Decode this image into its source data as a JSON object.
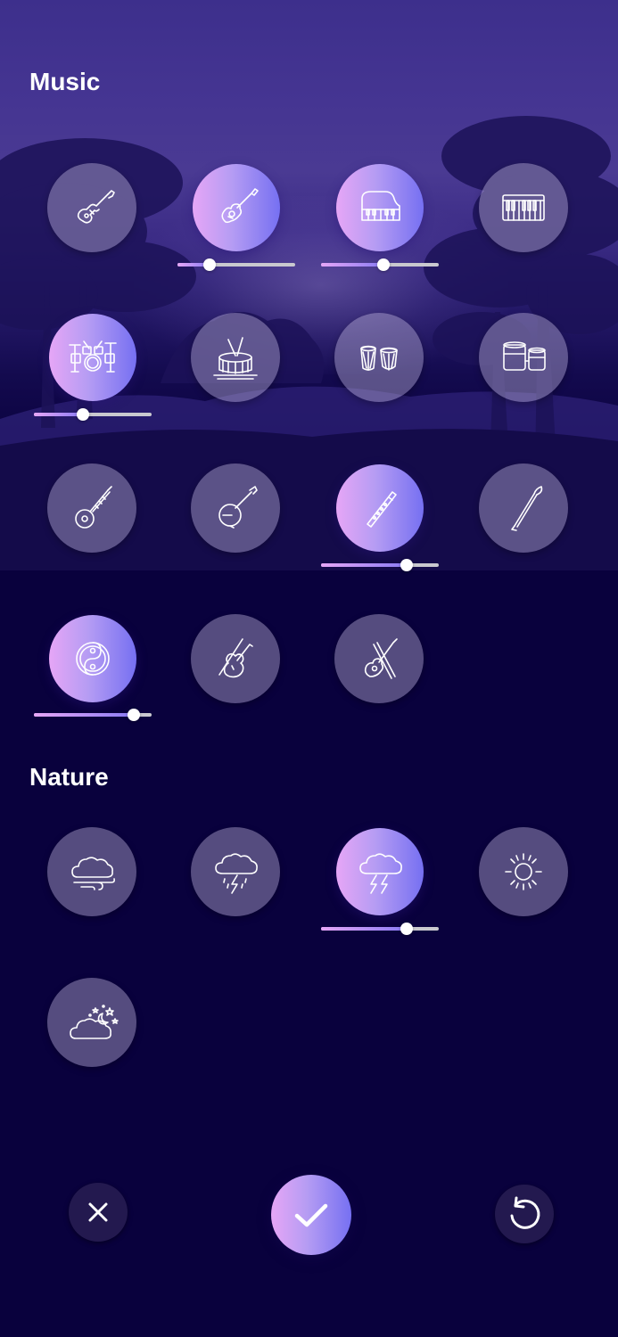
{
  "sections": {
    "music_title": "Music",
    "nature_title": "Nature"
  },
  "music": [
    {
      "name": "electric-guitar",
      "icon": "electric-guitar-icon",
      "active": false
    },
    {
      "name": "acoustic-guitar",
      "icon": "acoustic-guitar-icon",
      "active": true,
      "volume": 0.27
    },
    {
      "name": "grand-piano",
      "icon": "grand-piano-icon",
      "active": true,
      "volume": 0.53
    },
    {
      "name": "keyboard",
      "icon": "keyboard-icon",
      "active": false
    },
    {
      "name": "drum-kit",
      "icon": "drum-kit-icon",
      "active": true,
      "volume": 0.42
    },
    {
      "name": "snare-drum",
      "icon": "snare-drum-icon",
      "active": false
    },
    {
      "name": "tabla",
      "icon": "tabla-icon",
      "active": false
    },
    {
      "name": "bongos",
      "icon": "bongos-icon",
      "active": false
    },
    {
      "name": "sitar",
      "icon": "sitar-icon",
      "active": false
    },
    {
      "name": "banjo",
      "icon": "banjo-icon",
      "active": false
    },
    {
      "name": "flute",
      "icon": "flute-icon",
      "active": true,
      "volume": 0.73
    },
    {
      "name": "shehnai",
      "icon": "shehnai-icon",
      "active": false
    },
    {
      "name": "yin-yang",
      "icon": "yin-yang-icon",
      "active": true,
      "volume": 0.85
    },
    {
      "name": "violin",
      "icon": "violin-icon",
      "active": false
    },
    {
      "name": "guitar-violin",
      "icon": "guitar-violin-icon",
      "active": false
    }
  ],
  "nature": [
    {
      "name": "cloud-wind",
      "icon": "cloud-wind-icon",
      "active": false
    },
    {
      "name": "rain-lightning",
      "icon": "rain-lightning-icon",
      "active": false
    },
    {
      "name": "thunderstorm",
      "icon": "thunderstorm-icon",
      "active": true,
      "volume": 0.73
    },
    {
      "name": "sun",
      "icon": "sun-icon",
      "active": false
    },
    {
      "name": "night-cloud",
      "icon": "night-cloud-icon",
      "active": false
    }
  ],
  "actions": {
    "close": "close-icon",
    "confirm": "check-icon",
    "reset": "reset-icon"
  },
  "colors": {
    "background": "#09013d",
    "sky": "#453592",
    "accent_start": "#e6a6f6",
    "accent_end": "#7670f2",
    "inactive_circle": "#beb6dc"
  }
}
